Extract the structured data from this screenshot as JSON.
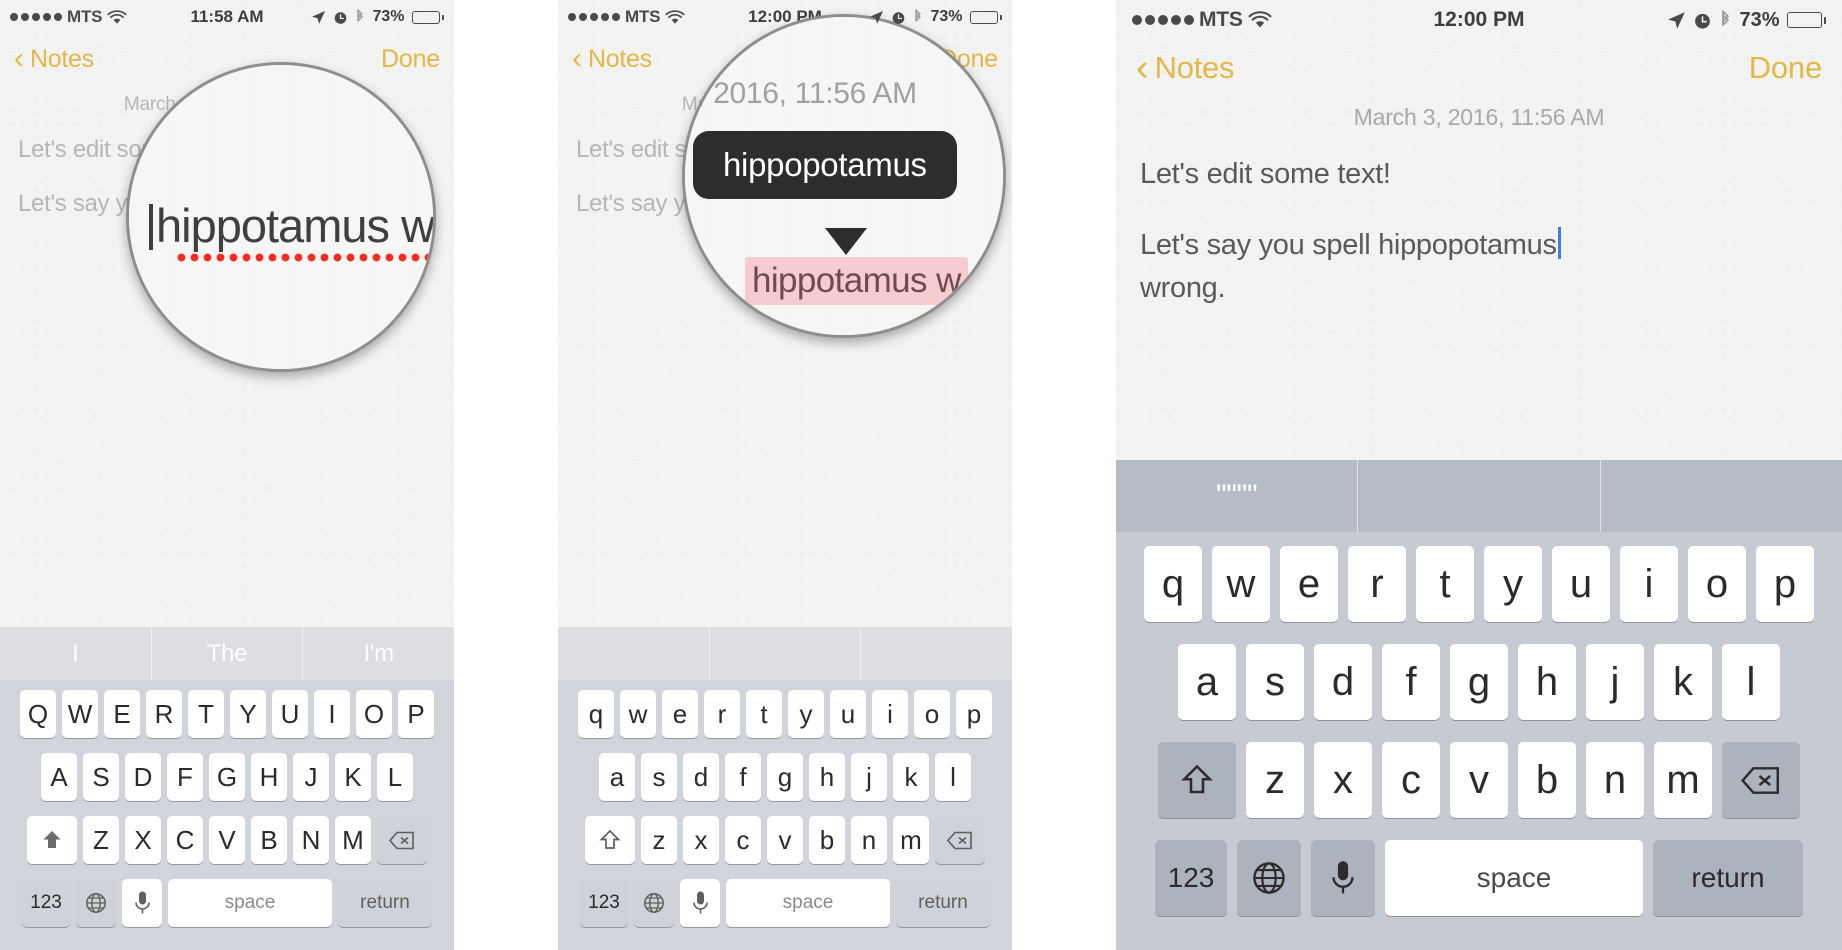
{
  "panels": [
    {
      "id": "panel-1-magnifier",
      "status": {
        "carrier": "MTS",
        "signal_dots": 5,
        "wifi": "wifi-icon",
        "time": "11:58 AM",
        "location": "location-arrow-icon",
        "alarm": "alarm-clock-icon",
        "bluetooth": "bluetooth-icon",
        "battery_pct": "73%",
        "battery_level": 73
      },
      "nav": {
        "back_label": "Notes",
        "back_icon": "chevron-left-icon",
        "done_label": "Done"
      },
      "note": {
        "date": "March 3, 2016, 11:56 AM",
        "line1": "Let's edit some text!",
        "line2": "Let's say you spell hippotamus wrong."
      },
      "loupe": {
        "word": "hippotamus",
        "suffix": "w",
        "underline": "spell-check-red-dots"
      },
      "keyboard": {
        "shift_state": "caps",
        "suggestions": [
          "I",
          "The",
          "I'm"
        ],
        "row1": [
          "Q",
          "W",
          "E",
          "R",
          "T",
          "Y",
          "U",
          "I",
          "O",
          "P"
        ],
        "row2": [
          "A",
          "S",
          "D",
          "F",
          "G",
          "H",
          "J",
          "K",
          "L"
        ],
        "row3": [
          "Z",
          "X",
          "C",
          "V",
          "B",
          "N",
          "M"
        ],
        "shift_icon": "shift-arrow-icon",
        "delete_icon": "backspace-icon",
        "numeric_label": "123",
        "globe_icon": "globe-icon",
        "mic_icon": "microphone-icon",
        "space_label": "space",
        "return_label": "return"
      }
    },
    {
      "id": "panel-2-suggestion",
      "status": {
        "carrier": "MTS",
        "signal_dots": 5,
        "wifi": "wifi-icon",
        "time": "12:00 PM",
        "location": "location-arrow-icon",
        "alarm": "alarm-clock-icon",
        "bluetooth": "bluetooth-icon",
        "battery_pct": "73%",
        "battery_level": 73
      },
      "nav": {
        "back_label": "Notes",
        "back_icon": "chevron-left-icon",
        "done_label": "Done"
      },
      "note": {
        "date": "March 3, 2016, 11:56 AM",
        "line1": "Let's edit some text!",
        "line2": "Let's say you spell hippotamus wrong."
      },
      "loupe": {
        "date_fragment": ", 2016, 11:56 AM",
        "suggestion": "hippopotamus",
        "misspelled": "hippotamus",
        "misspelled_suffix": "w"
      },
      "keyboard": {
        "shift_state": "off",
        "suggestions": [
          "",
          "",
          ""
        ],
        "row1": [
          "q",
          "w",
          "e",
          "r",
          "t",
          "y",
          "u",
          "i",
          "o",
          "p"
        ],
        "row2": [
          "a",
          "s",
          "d",
          "f",
          "g",
          "h",
          "j",
          "k",
          "l"
        ],
        "row3": [
          "z",
          "x",
          "c",
          "v",
          "b",
          "n",
          "m"
        ],
        "shift_icon": "shift-arrow-icon",
        "delete_icon": "backspace-icon",
        "numeric_label": "123",
        "globe_icon": "globe-icon",
        "mic_icon": "microphone-icon",
        "space_label": "space",
        "return_label": "return"
      }
    },
    {
      "id": "panel-3-corrected",
      "status": {
        "carrier": "MTS",
        "signal_dots": 5,
        "wifi": "wifi-icon",
        "time": "12:00 PM",
        "location": "location-arrow-icon",
        "alarm": "alarm-clock-icon",
        "bluetooth": "bluetooth-icon",
        "battery_pct": "73%",
        "battery_level": 73
      },
      "nav": {
        "back_label": "Notes",
        "back_icon": "chevron-left-icon",
        "done_label": "Done"
      },
      "note": {
        "date": "March 3, 2016, 11:56 AM",
        "line1": "Let's edit some text!",
        "line2a": "Let's say you spell hippopotamus",
        "line2b": "wrong."
      },
      "keyboard": {
        "shift_state": "off",
        "suggestions": [
          "\"\"\"\"",
          "",
          ""
        ],
        "row1": [
          "q",
          "w",
          "e",
          "r",
          "t",
          "y",
          "u",
          "i",
          "o",
          "p"
        ],
        "row2": [
          "a",
          "s",
          "d",
          "f",
          "g",
          "h",
          "j",
          "k",
          "l"
        ],
        "row3": [
          "z",
          "x",
          "c",
          "v",
          "b",
          "n",
          "m"
        ],
        "shift_icon": "shift-arrow-icon",
        "delete_icon": "backspace-icon",
        "numeric_label": "123",
        "globe_icon": "globe-icon",
        "mic_icon": "microphone-icon",
        "space_label": "space",
        "return_label": "return"
      }
    }
  ],
  "colors": {
    "accent_gold": "#e3b748",
    "spell_red": "#fb2a20",
    "highlight_pink": "#f6ccd0",
    "bubble_dark": "#2d2d2d",
    "caret_blue": "#3b7ef2",
    "keyboard_light": "#d1d4da",
    "keyboard_dark": "#b6bcc5"
  }
}
